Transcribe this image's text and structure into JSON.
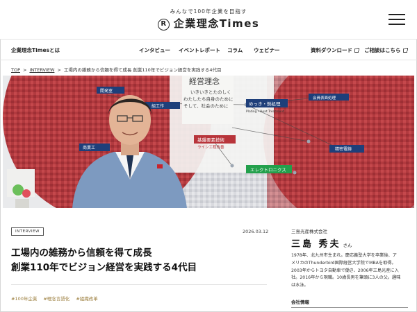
{
  "header": {
    "tagline": "みんなで100年企業を目指す",
    "logo_mark": "R",
    "logo_text": "企業理念Times"
  },
  "nav": {
    "about": "企業理念Timesとは",
    "items": [
      "インタビュー",
      "イベントレポート",
      "コラム",
      "ウェビナー"
    ],
    "download": "資料ダウンロード",
    "contact": "ご相談はこちら"
  },
  "breadcrumb": {
    "top": "TOP",
    "category": "INTERVIEW",
    "current": "工場内の雑務から信頼を得て成長 創業110年でビジョン経営を実践する4代目"
  },
  "hero": {
    "board_title": "経営理念",
    "board_lines": [
      "いきいきとたのしく",
      "わたしたち自身のために",
      "そして、社会のために"
    ],
    "labels": [
      "開発室",
      "組工作",
      "基盤要素技術",
      "ライン工程改善",
      "商業工",
      "めっき・熱処理",
      "Plating・Heat Treatment",
      "会員表面処理",
      "精密電鋳",
      "エレクトロニクス"
    ],
    "colors": {
      "red": "#b8353b",
      "navy": "#1e3f7a",
      "green": "#23a04c",
      "blue": "#2f6fb5"
    }
  },
  "article": {
    "badge": "INTERVIEW",
    "date": "2026.03.12",
    "title_line1": "工場内の雑務から信頼を得て成長",
    "title_line2": "創業110年でビジョン経営を実践する4代目",
    "tags": [
      "#100年企業",
      "#理念言語化",
      "#組織改革"
    ]
  },
  "profile": {
    "company": "三島光産株式会社",
    "name": "三島 秀夫",
    "honorific": "さん",
    "bio": [
      "1978年、北九州市生まれ。慶応義塾大学を卒業後、ア",
      "メリカのThunderbird国際経営大学院でMBAを取得。",
      "2003年からトヨタ自動車で働き、2006年三島光産に入",
      "社。2016年から現職。10歳長男を筆頭に3人の父。趣味",
      "は水泳。"
    ],
    "company_info": "会社情報"
  }
}
